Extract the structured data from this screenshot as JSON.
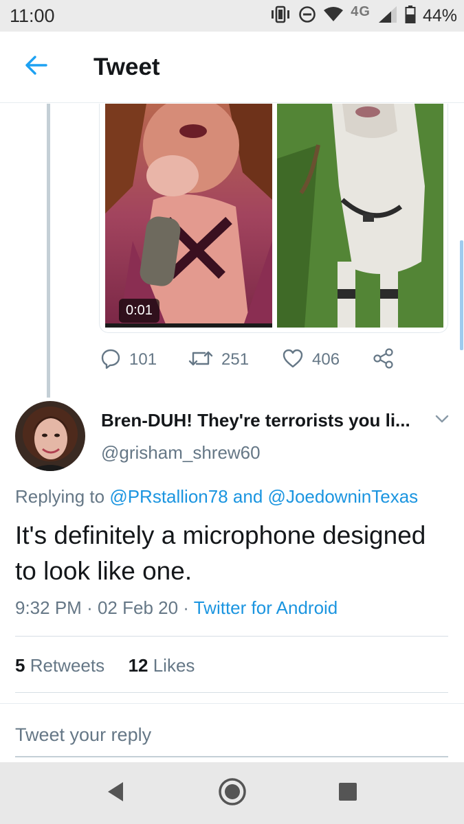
{
  "status_bar": {
    "time": "11:00",
    "network": "4G",
    "battery": "44%",
    "icons": [
      "vibrate-icon",
      "do-not-disturb-icon",
      "wifi-icon",
      "lte-icon",
      "signal-icon",
      "battery-icon"
    ]
  },
  "app_bar": {
    "title": "Tweet",
    "back_icon": "arrow-left-icon"
  },
  "media": {
    "video_time": "0:01"
  },
  "actions": {
    "replies": "101",
    "retweets": "251",
    "likes": "406"
  },
  "reply_tweet": {
    "display_name": "Bren-DUH! They're terrorists you li...",
    "handle": "@grisham_shrew60",
    "replying_prefix": "Replying to",
    "mention_1": "@PRstallion78",
    "and_word": "and",
    "mention_2": "@JoedowninTexas",
    "text": "It's definitely a microphone designed to look like one.",
    "time": "9:32 PM",
    "separator": "·",
    "date": "02 Feb 20",
    "source": "Twitter for Android",
    "retweet_count": "5",
    "retweet_label": "Retweets",
    "like_count": "12",
    "like_label": "Likes"
  },
  "reply_box": {
    "placeholder": "Tweet your reply"
  },
  "colors": {
    "accent": "#1da1f2",
    "link": "#1b95e0",
    "secondary_text": "#657786"
  }
}
